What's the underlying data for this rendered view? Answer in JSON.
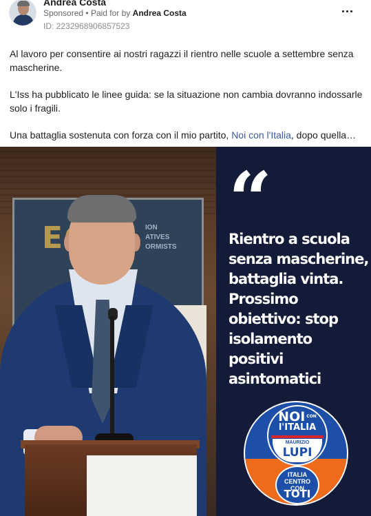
{
  "post": {
    "author": "Andrea Costa",
    "sponsored_label": "Sponsored",
    "separator": "•",
    "paid_for_prefix": "Paid for by",
    "paid_for_by": "Andrea Costa",
    "ad_id": "ID: 2232968906857523",
    "more_icon": "more-options-icon",
    "paragraphs": [
      "Al lavoro per consentire ai nostri ragazzi il rientro nelle scuole a settembre senza mascherine.",
      "L'Iss ha pubblicato le linee guida: se la situazione non cambia dovranno indossarle solo i fragili."
    ],
    "last_paragraph": {
      "before_link": "Una battaglia sostenuta con forza con il mio partito, ",
      "link": "Noi con l'Italia",
      "after_link": ", dopo quella…"
    },
    "link_color": "#385898"
  },
  "creative": {
    "banner_logo": "EC",
    "banner_text": "ION\nATIVES\nORMISTS",
    "quote_mark": "“",
    "quote_text": "Rientro a scuola senza mascherine, battaglia vinta. Prossimo obiettivo: stop isolamento positivi asintomatici",
    "panel_color": "#141b38",
    "party_logo": {
      "noi": "NOI",
      "con": "CON",
      "italia": "l'ITALIA",
      "maurizio": "MAURIZIO",
      "lupi": "LUPI",
      "italia_centro": "ITALIA\nCENTRO\nCON",
      "toti": "TOTI",
      "blue": "#1d4fa8",
      "orange": "#ef6b1c"
    }
  }
}
